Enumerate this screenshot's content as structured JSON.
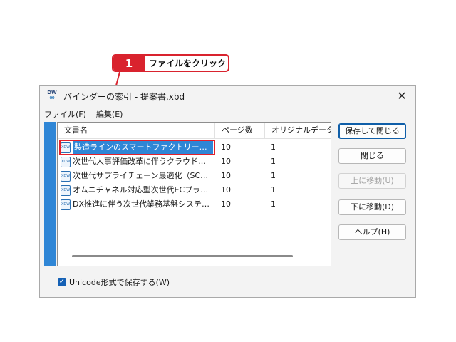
{
  "callout": {
    "number": "1",
    "text": "ファイルをクリック"
  },
  "window": {
    "icon_text": "DW",
    "title": "バインダーの索引 - 提案書.xbd",
    "close_label": "✕"
  },
  "menu": [
    {
      "label": "ファイル(F)"
    },
    {
      "label": "編集(E)"
    }
  ],
  "table": {
    "columns": [
      "文書名",
      "ページ数",
      "オリジナルデータ数"
    ],
    "file_icon_label": "XDW",
    "rows": [
      {
        "name": "製造ラインのスマートファクトリー化に伴う…",
        "pages": "10",
        "original": "1",
        "selected": true
      },
      {
        "name": "次世代人事評価改革に伴うクラウド型…",
        "pages": "10",
        "original": "1",
        "selected": false
      },
      {
        "name": "次世代サプライチェーン最適化（SCM…",
        "pages": "10",
        "original": "1",
        "selected": false
      },
      {
        "name": "オムニチャネル対応型次世代ECプラット…",
        "pages": "10",
        "original": "1",
        "selected": false
      },
      {
        "name": "DX推進に伴う次世代業務基盤システ…",
        "pages": "10",
        "original": "1",
        "selected": false
      }
    ]
  },
  "buttons": {
    "save_close": "保存して閉じる",
    "close": "閉じる",
    "move_up": "上に移動(U)",
    "move_down": "下に移動(D)",
    "help": "ヘルプ(H)"
  },
  "checkbox": {
    "checked": true,
    "label": "Unicode形式で保存する(W)"
  },
  "colors": {
    "accent": "#2f86d6",
    "callout_red": "#d9232e"
  }
}
